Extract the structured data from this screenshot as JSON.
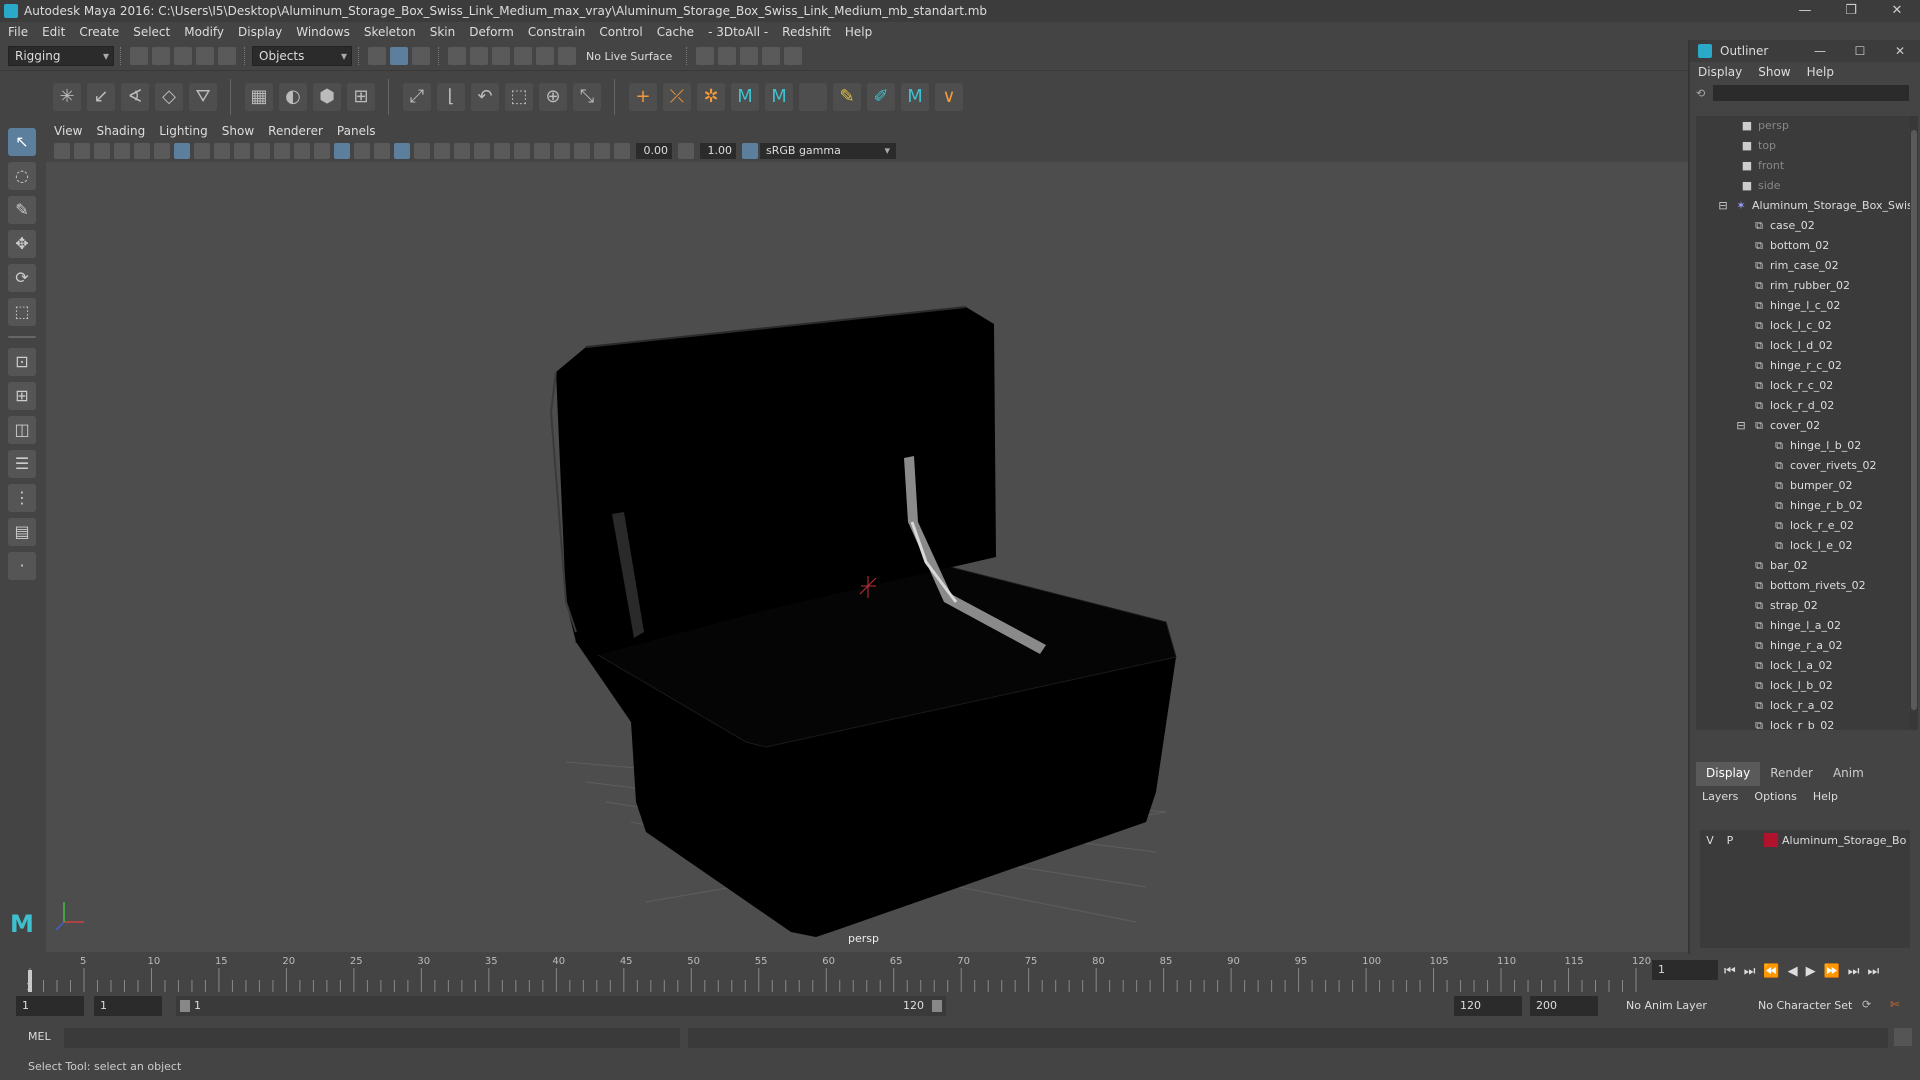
{
  "window": {
    "title": "Autodesk Maya 2016: C:\\Users\\I5\\Desktop\\Aluminum_Storage_Box_Swiss_Link_Medium_max_vray\\Aluminum_Storage_Box_Swiss_Link_Medium_mb_standart.mb",
    "minimize": "—",
    "restore": "❐",
    "close": "✕"
  },
  "menubar": [
    "File",
    "Edit",
    "Create",
    "Select",
    "Modify",
    "Display",
    "Windows",
    "Skeleton",
    "Skin",
    "Deform",
    "Constrain",
    "Control",
    "Cache",
    "- 3DtoAll -",
    "Redshift",
    "Help"
  ],
  "statusline": {
    "mode": "Rigging",
    "selection_mask": "Objects",
    "live_surface": "No Live Surface"
  },
  "viewport": {
    "menus": [
      "View",
      "Shading",
      "Lighting",
      "Show",
      "Renderer",
      "Panels"
    ],
    "exposure": "0.00",
    "gamma_value": "1.00",
    "color_space": "sRGB gamma",
    "camera_label": "persp"
  },
  "timeline": {
    "ticks": [
      "1",
      "5",
      "10",
      "15",
      "20",
      "25",
      "30",
      "35",
      "40",
      "45",
      "50",
      "55",
      "60",
      "65",
      "70",
      "75",
      "80",
      "85",
      "90",
      "95",
      "100",
      "105",
      "110",
      "115",
      "120"
    ],
    "current_frame": "1"
  },
  "range": {
    "start": "1",
    "start_inner": "1",
    "slider_start": "1",
    "slider_end": "120",
    "end_inner": "120",
    "end": "200",
    "anim_layer": "No Anim Layer",
    "character_set": "No Character Set"
  },
  "command": {
    "lang": "MEL"
  },
  "helpline": "Select Tool: select an object",
  "outliner": {
    "title": "Outliner",
    "menus": [
      "Display",
      "Show",
      "Help"
    ],
    "cameras": [
      "persp",
      "top",
      "front",
      "side"
    ],
    "root": "Aluminum_Storage_Box_Swis",
    "items_a": [
      "case_02",
      "bottom_02",
      "rim_case_02",
      "rim_rubber_02",
      "hinge_l_c_02",
      "lock_l_c_02",
      "lock_l_d_02",
      "hinge_r_c_02",
      "lock_r_c_02",
      "lock_r_d_02"
    ],
    "cover": "cover_02",
    "cover_children": [
      "hinge_l_b_02",
      "cover_rivets_02",
      "bumper_02",
      "hinge_r_b_02",
      "lock_r_e_02",
      "lock_l_e_02"
    ],
    "items_b": [
      "bar_02",
      "bottom_rivets_02",
      "strap_02",
      "hinge_l_a_02",
      "hinge_r_a_02",
      "lock_l_a_02",
      "lock_l_b_02",
      "lock_r_a_02",
      "lock_r_b_02"
    ]
  },
  "layers": {
    "tabs": [
      "Display",
      "Render",
      "Anim"
    ],
    "menus": [
      "Layers",
      "Options",
      "Help"
    ],
    "row": {
      "v": "V",
      "p": "P",
      "name": "Aluminum_Storage_Bo",
      "color": "#b3122e"
    }
  }
}
